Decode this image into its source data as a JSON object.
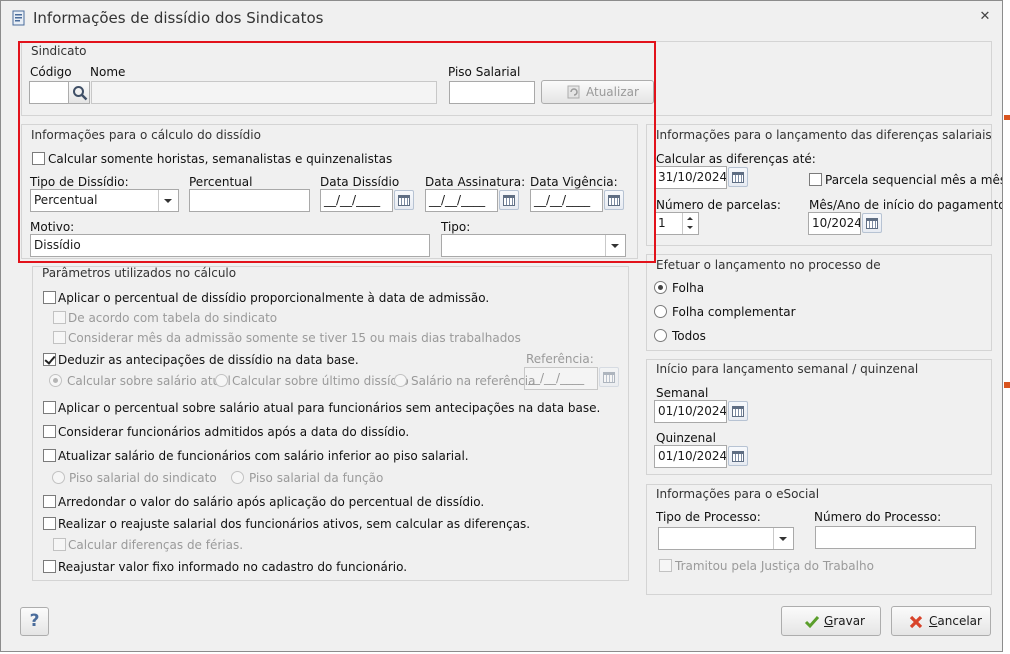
{
  "window": {
    "title": "Informações de dissídio dos Sindicatos"
  },
  "sindicato": {
    "group_title": "Sindicato",
    "codigo_label": "Código",
    "codigo_value": "",
    "nome_label": "Nome",
    "nome_value": "",
    "piso_label": "Piso Salarial",
    "piso_value": "",
    "atualizar_label": "Atualizar"
  },
  "calculo": {
    "group_title": "Informações para o cálculo do dissídio",
    "horistas_label": "Calcular somente horistas, semanalistas e quinzenalistas",
    "tipo_dissidio_label": "Tipo de Dissídio:",
    "tipo_dissidio_value": "Percentual",
    "percentual_label": "Percentual",
    "percentual_value": "",
    "data_dissidio_label": "Data Dissídio",
    "data_dissidio_value": "__/__/____",
    "data_assinatura_label": "Data Assinatura:",
    "data_assinatura_value": "__/__/____",
    "data_vigencia_label": "Data Vigência:",
    "data_vigencia_value": "__/__/____",
    "motivo_label": "Motivo:",
    "motivo_value": "Dissídio",
    "tipo_label": "Tipo:",
    "tipo_value": ""
  },
  "parametros": {
    "group_title": "Parâmetros utilizados no cálculo",
    "aplicar_proporcional": "Aplicar o percentual de dissídio proporcionalmente à data de admissão.",
    "tabela_sindicato": "De acordo com tabela do sindicato",
    "considerar_mes": "Considerar mês da admissão somente se tiver 15 ou mais dias trabalhados",
    "deduzir": "Deduzir as antecipações de dissídio na data base.",
    "referencia_label": "Referência:",
    "referencia_value": "__/__/____",
    "radio_atual": "Calcular sobre salário atual",
    "radio_ultimo": "Calcular sobre último dissídio",
    "radio_referencia": "Salário na referência",
    "aplicar_sem_antecipacoes": "Aplicar o percentual sobre salário atual para funcionários sem antecipações na data base.",
    "considerar_admitidos": "Considerar funcionários admitidos após a data do dissídio.",
    "atualizar_piso": "Atualizar salário de funcionários com salário inferior ao piso salarial.",
    "piso_sindicato": "Piso salarial do sindicato",
    "piso_funcao": "Piso salarial da função",
    "arredondar": "Arredondar o valor do salário após aplicação do percentual de dissídio.",
    "realizar_reajuste": "Realizar o reajuste salarial dos funcionários ativos, sem calcular as diferenças.",
    "calcular_ferias": "Calcular diferenças de férias.",
    "reajustar_fixo": "Reajustar valor fixo informado no cadastro do funcionário."
  },
  "lancamento": {
    "group_title": "Informações para o lançamento das diferenças salariais",
    "calcular_ate_label": "Calcular as diferenças até:",
    "calcular_ate_value": "31/10/2024",
    "parcela_sequencial": "Parcela sequencial mês a mês",
    "num_parcelas_label": "Número de parcelas:",
    "num_parcelas_value": "1",
    "mes_ano_label": "Mês/Ano de início do pagamento:",
    "mes_ano_value": "10/2024"
  },
  "processo": {
    "group_title": "Efetuar o lançamento no processo de",
    "folha": "Folha",
    "folha_complementar": "Folha complementar",
    "todos": "Todos"
  },
  "semanal": {
    "group_title": "Início para lançamento semanal / quinzenal",
    "semanal_label": "Semanal",
    "semanal_value": "01/10/2024",
    "quinzenal_label": "Quinzenal",
    "quinzenal_value": "01/10/2024"
  },
  "esocial": {
    "group_title": "Informações para o eSocial",
    "tipo_processo_label": "Tipo de Processo:",
    "tipo_processo_value": "",
    "numero_processo_label": "Número do Processo:",
    "numero_processo_value": "",
    "tramitou": "Tramitou pela Justiça do Trabalho"
  },
  "footer": {
    "help": "?",
    "gravar_rest": "ravar",
    "gravar_u": "G",
    "cancelar_rest": "ancelar",
    "cancelar_u": "C"
  },
  "colors": {
    "highlight": "#e2121b",
    "ok_icon": "#5a9e2b",
    "cancel_icon": "#d8432a"
  }
}
